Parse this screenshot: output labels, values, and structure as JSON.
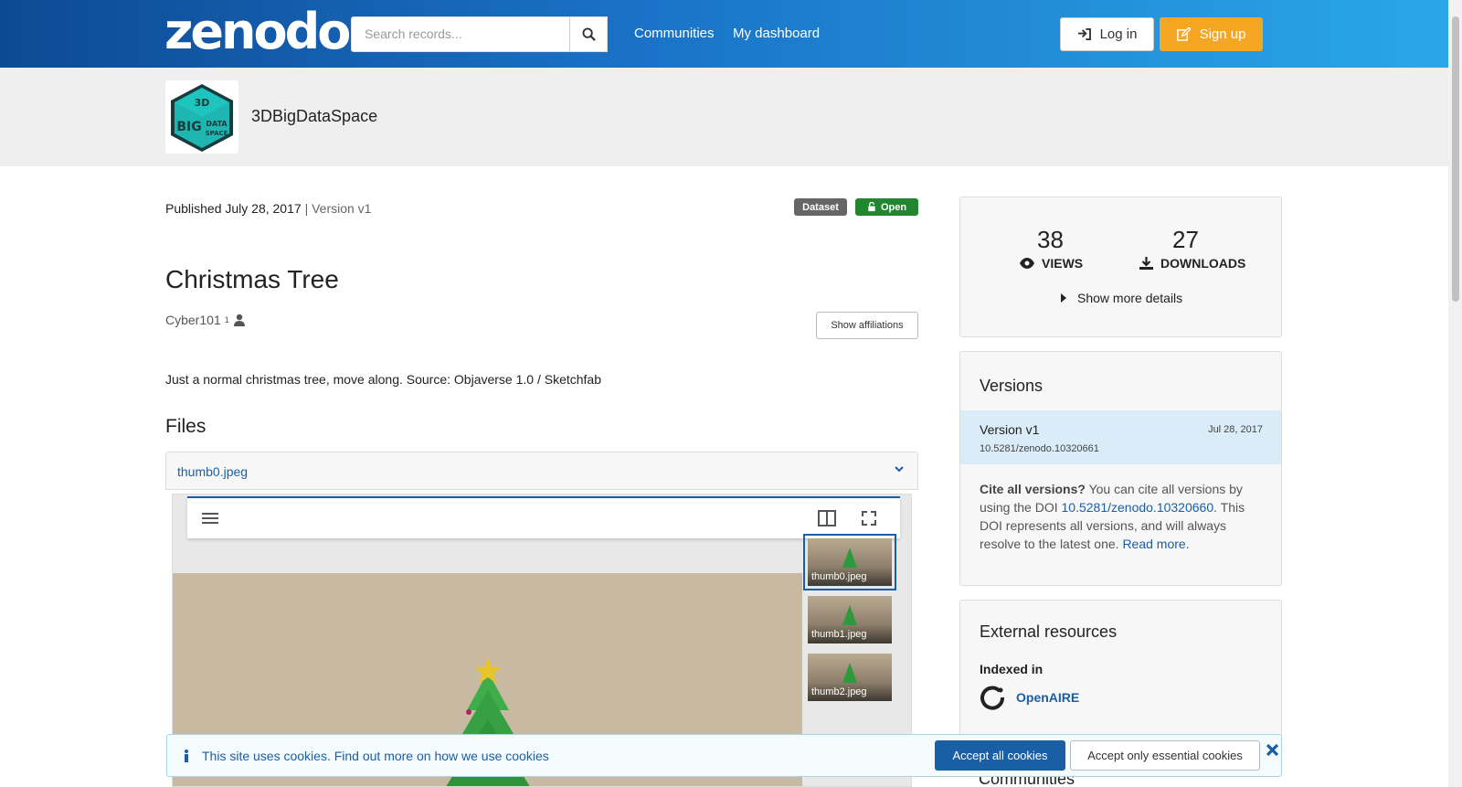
{
  "header": {
    "logo": "zenodo",
    "search_placeholder": "Search records...",
    "nav": [
      "Communities",
      "My dashboard"
    ],
    "login_label": "Log in",
    "signup_label": "Sign up"
  },
  "community": {
    "name": "3DBigDataSpace",
    "logo_lines": [
      "3D",
      "BIG",
      "DATA",
      "SPACE"
    ]
  },
  "record": {
    "published": "Published July 28, 2017",
    "version": "| Version v1",
    "badge_type": "Dataset",
    "badge_access": "Open",
    "title": "Christmas Tree",
    "creator": "Cyber101",
    "creator_sup": "1",
    "show_affiliations": "Show affiliations",
    "description": "Just a normal christmas tree, move along. Source: Objaverse 1.0 / Sketchfab"
  },
  "files": {
    "heading": "Files",
    "current": "thumb0.jpeg",
    "thumbs": [
      "thumb0.jpeg",
      "thumb1.jpeg",
      "thumb2.jpeg"
    ]
  },
  "stats": {
    "views": "38",
    "views_label": "VIEWS",
    "downloads": "27",
    "downloads_label": "DOWNLOADS",
    "more": "Show more details"
  },
  "versions": {
    "heading": "Versions",
    "name": "Version v1",
    "date": "Jul 28, 2017",
    "doi": "10.5281/zenodo.10320661",
    "cite_bold": "Cite all versions?",
    "cite_1": " You can cite all versions by using the DOI ",
    "cite_doi": "10.5281/zenodo.10320660",
    "cite_2": ". This DOI represents all versions, and will always resolve to the latest one. ",
    "read_more": "Read more."
  },
  "external": {
    "heading": "External resources",
    "indexed": "Indexed in",
    "openaire": "OpenAIRE"
  },
  "communities_heading": "Communities",
  "cookie": {
    "text": "This site uses cookies. Find out more on ",
    "link": "how we use cookies",
    "accept_all": "Accept all cookies",
    "accept_essential": "Accept only essential cookies"
  },
  "colors": {
    "brand_blue": "#1a5fa5",
    "signup_orange": "#f5a623",
    "open_green": "#21862f",
    "teal_logo": "#1fb5b0"
  }
}
